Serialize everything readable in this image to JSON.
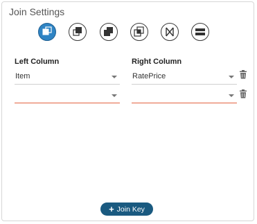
{
  "panel": {
    "title": "Join Settings"
  },
  "join_types": [
    {
      "name": "left-join-icon",
      "active": true
    },
    {
      "name": "right-join-icon",
      "active": false
    },
    {
      "name": "outer-join-icon",
      "active": false
    },
    {
      "name": "inner-join-icon",
      "active": false
    },
    {
      "name": "cross-join-icon",
      "active": false
    },
    {
      "name": "union-icon",
      "active": false
    }
  ],
  "columns": {
    "left_header": "Left Column",
    "right_header": "Right Column"
  },
  "keys": [
    {
      "left": "Item",
      "right": "RatePrice"
    },
    {
      "left": "",
      "right": ""
    }
  ],
  "actions": {
    "add_key_label": "Join Key"
  },
  "colors": {
    "accent": "#2f84c4",
    "button": "#1a5a80",
    "invalid_underline": "#e3623e"
  }
}
